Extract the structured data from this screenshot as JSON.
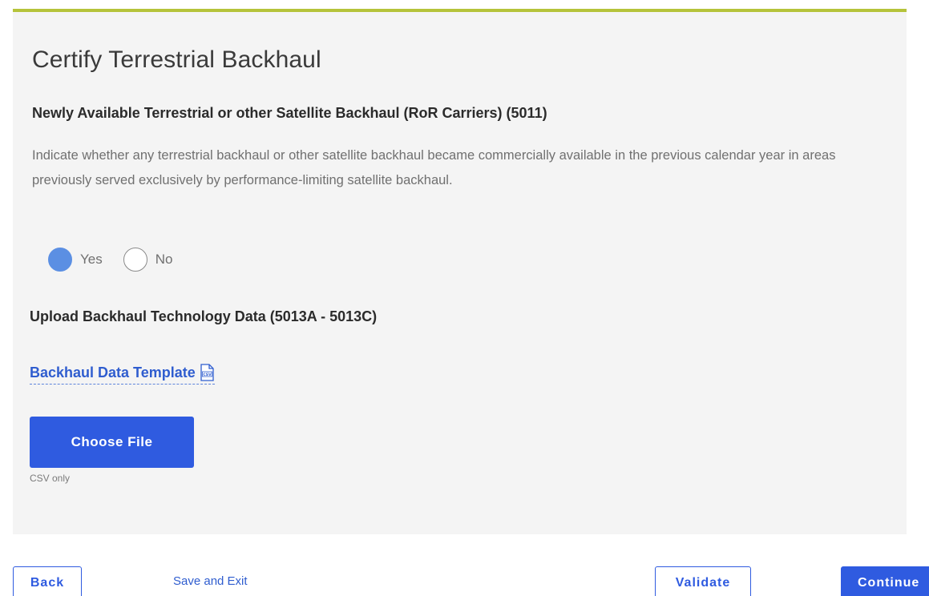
{
  "form": {
    "title": "Certify Terrestrial Backhaul",
    "subtitle": "Newly Available Terrestrial or other Satellite Backhaul (RoR Carriers) (5011)",
    "description": "Indicate whether any terrestrial backhaul or other satellite backhaul became commercially available in the previous calendar year in areas previously served exclusively by performance-limiting satellite backhaul.",
    "radio": {
      "selected": "Yes",
      "options": [
        {
          "label": "Yes"
        },
        {
          "label": "No"
        }
      ]
    },
    "upload_heading": "Upload Backhaul Technology Data (5013A - 5013C)",
    "template_link": "Backhaul Data Template",
    "csv_icon": "csv-file-icon",
    "choose_file_label": "Choose File",
    "file_hint": "CSV only"
  },
  "footer": {
    "back_label": "Back",
    "save_exit_label": "Save and Exit",
    "validate_label": "Validate",
    "continue_label": "Continue"
  },
  "colors": {
    "accent_bar": "#b5c33a",
    "primary": "#2f5be0",
    "radio_selected": "#5b8fe3",
    "card_bg": "#f4f4f4"
  }
}
